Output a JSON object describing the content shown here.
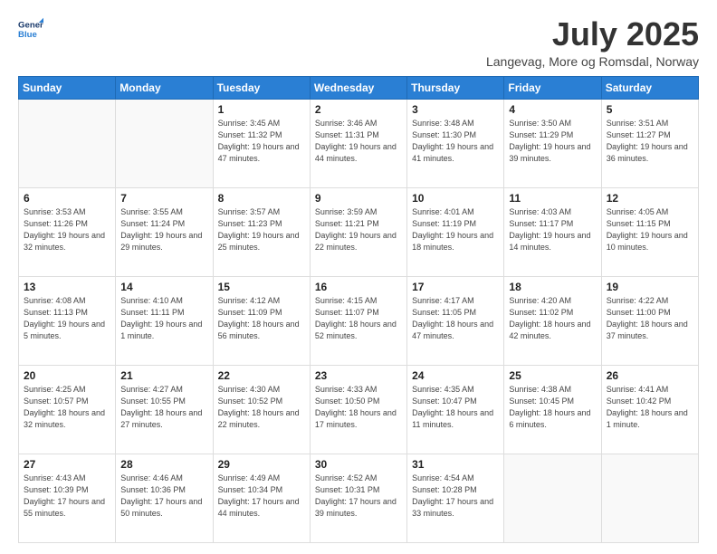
{
  "header": {
    "logo_line1": "General",
    "logo_line2": "Blue",
    "month": "July 2025",
    "location": "Langevag, More og Romsdal, Norway"
  },
  "weekdays": [
    "Sunday",
    "Monday",
    "Tuesday",
    "Wednesday",
    "Thursday",
    "Friday",
    "Saturday"
  ],
  "weeks": [
    [
      {
        "day": "",
        "info": ""
      },
      {
        "day": "",
        "info": ""
      },
      {
        "day": "1",
        "info": "Sunrise: 3:45 AM\nSunset: 11:32 PM\nDaylight: 19 hours\nand 47 minutes."
      },
      {
        "day": "2",
        "info": "Sunrise: 3:46 AM\nSunset: 11:31 PM\nDaylight: 19 hours\nand 44 minutes."
      },
      {
        "day": "3",
        "info": "Sunrise: 3:48 AM\nSunset: 11:30 PM\nDaylight: 19 hours\nand 41 minutes."
      },
      {
        "day": "4",
        "info": "Sunrise: 3:50 AM\nSunset: 11:29 PM\nDaylight: 19 hours\nand 39 minutes."
      },
      {
        "day": "5",
        "info": "Sunrise: 3:51 AM\nSunset: 11:27 PM\nDaylight: 19 hours\nand 36 minutes."
      }
    ],
    [
      {
        "day": "6",
        "info": "Sunrise: 3:53 AM\nSunset: 11:26 PM\nDaylight: 19 hours\nand 32 minutes."
      },
      {
        "day": "7",
        "info": "Sunrise: 3:55 AM\nSunset: 11:24 PM\nDaylight: 19 hours\nand 29 minutes."
      },
      {
        "day": "8",
        "info": "Sunrise: 3:57 AM\nSunset: 11:23 PM\nDaylight: 19 hours\nand 25 minutes."
      },
      {
        "day": "9",
        "info": "Sunrise: 3:59 AM\nSunset: 11:21 PM\nDaylight: 19 hours\nand 22 minutes."
      },
      {
        "day": "10",
        "info": "Sunrise: 4:01 AM\nSunset: 11:19 PM\nDaylight: 19 hours\nand 18 minutes."
      },
      {
        "day": "11",
        "info": "Sunrise: 4:03 AM\nSunset: 11:17 PM\nDaylight: 19 hours\nand 14 minutes."
      },
      {
        "day": "12",
        "info": "Sunrise: 4:05 AM\nSunset: 11:15 PM\nDaylight: 19 hours\nand 10 minutes."
      }
    ],
    [
      {
        "day": "13",
        "info": "Sunrise: 4:08 AM\nSunset: 11:13 PM\nDaylight: 19 hours\nand 5 minutes."
      },
      {
        "day": "14",
        "info": "Sunrise: 4:10 AM\nSunset: 11:11 PM\nDaylight: 19 hours\nand 1 minute."
      },
      {
        "day": "15",
        "info": "Sunrise: 4:12 AM\nSunset: 11:09 PM\nDaylight: 18 hours\nand 56 minutes."
      },
      {
        "day": "16",
        "info": "Sunrise: 4:15 AM\nSunset: 11:07 PM\nDaylight: 18 hours\nand 52 minutes."
      },
      {
        "day": "17",
        "info": "Sunrise: 4:17 AM\nSunset: 11:05 PM\nDaylight: 18 hours\nand 47 minutes."
      },
      {
        "day": "18",
        "info": "Sunrise: 4:20 AM\nSunset: 11:02 PM\nDaylight: 18 hours\nand 42 minutes."
      },
      {
        "day": "19",
        "info": "Sunrise: 4:22 AM\nSunset: 11:00 PM\nDaylight: 18 hours\nand 37 minutes."
      }
    ],
    [
      {
        "day": "20",
        "info": "Sunrise: 4:25 AM\nSunset: 10:57 PM\nDaylight: 18 hours\nand 32 minutes."
      },
      {
        "day": "21",
        "info": "Sunrise: 4:27 AM\nSunset: 10:55 PM\nDaylight: 18 hours\nand 27 minutes."
      },
      {
        "day": "22",
        "info": "Sunrise: 4:30 AM\nSunset: 10:52 PM\nDaylight: 18 hours\nand 22 minutes."
      },
      {
        "day": "23",
        "info": "Sunrise: 4:33 AM\nSunset: 10:50 PM\nDaylight: 18 hours\nand 17 minutes."
      },
      {
        "day": "24",
        "info": "Sunrise: 4:35 AM\nSunset: 10:47 PM\nDaylight: 18 hours\nand 11 minutes."
      },
      {
        "day": "25",
        "info": "Sunrise: 4:38 AM\nSunset: 10:45 PM\nDaylight: 18 hours\nand 6 minutes."
      },
      {
        "day": "26",
        "info": "Sunrise: 4:41 AM\nSunset: 10:42 PM\nDaylight: 18 hours\nand 1 minute."
      }
    ],
    [
      {
        "day": "27",
        "info": "Sunrise: 4:43 AM\nSunset: 10:39 PM\nDaylight: 17 hours\nand 55 minutes."
      },
      {
        "day": "28",
        "info": "Sunrise: 4:46 AM\nSunset: 10:36 PM\nDaylight: 17 hours\nand 50 minutes."
      },
      {
        "day": "29",
        "info": "Sunrise: 4:49 AM\nSunset: 10:34 PM\nDaylight: 17 hours\nand 44 minutes."
      },
      {
        "day": "30",
        "info": "Sunrise: 4:52 AM\nSunset: 10:31 PM\nDaylight: 17 hours\nand 39 minutes."
      },
      {
        "day": "31",
        "info": "Sunrise: 4:54 AM\nSunset: 10:28 PM\nDaylight: 17 hours\nand 33 minutes."
      },
      {
        "day": "",
        "info": ""
      },
      {
        "day": "",
        "info": ""
      }
    ]
  ]
}
